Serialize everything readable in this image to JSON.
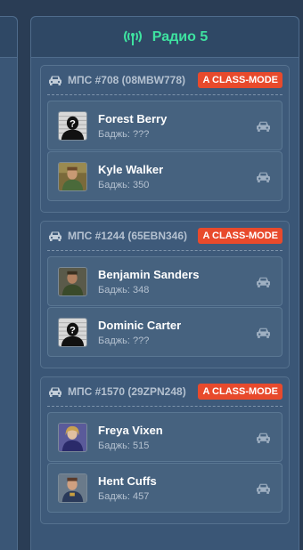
{
  "radio": {
    "title": "Радио 5",
    "icon": "radio-antenna-icon",
    "accent": "#3ee2a0"
  },
  "units": [
    {
      "name": "МПС #708 (08MBW778)",
      "badge": "A CLASS-MODE",
      "members": [
        {
          "name": "Forest Berry",
          "badge": "Баджь: ???",
          "avatar": "unknown"
        },
        {
          "name": "Kyle Walker",
          "badge": "Баджь: 350",
          "avatar": "photo"
        }
      ]
    },
    {
      "name": "МПС #1244 (65EBN346)",
      "badge": "A CLASS-MODE",
      "members": [
        {
          "name": "Benjamin Sanders",
          "badge": "Баджь: 348",
          "avatar": "photo"
        },
        {
          "name": "Dominic Carter",
          "badge": "Баджь: ???",
          "avatar": "unknown"
        }
      ]
    },
    {
      "name": "МПС #1570 (29ZPN248)",
      "badge": "A CLASS-MODE",
      "members": [
        {
          "name": "Freya Vixen",
          "badge": "Баджь: 515",
          "avatar": "photo"
        },
        {
          "name": "Hent Cuffs",
          "badge": "Баджь: 457",
          "avatar": "photo"
        }
      ]
    }
  ],
  "colors": {
    "badge": "#e84a2c",
    "panel": "#3a5676",
    "background": "#2a3d55"
  }
}
